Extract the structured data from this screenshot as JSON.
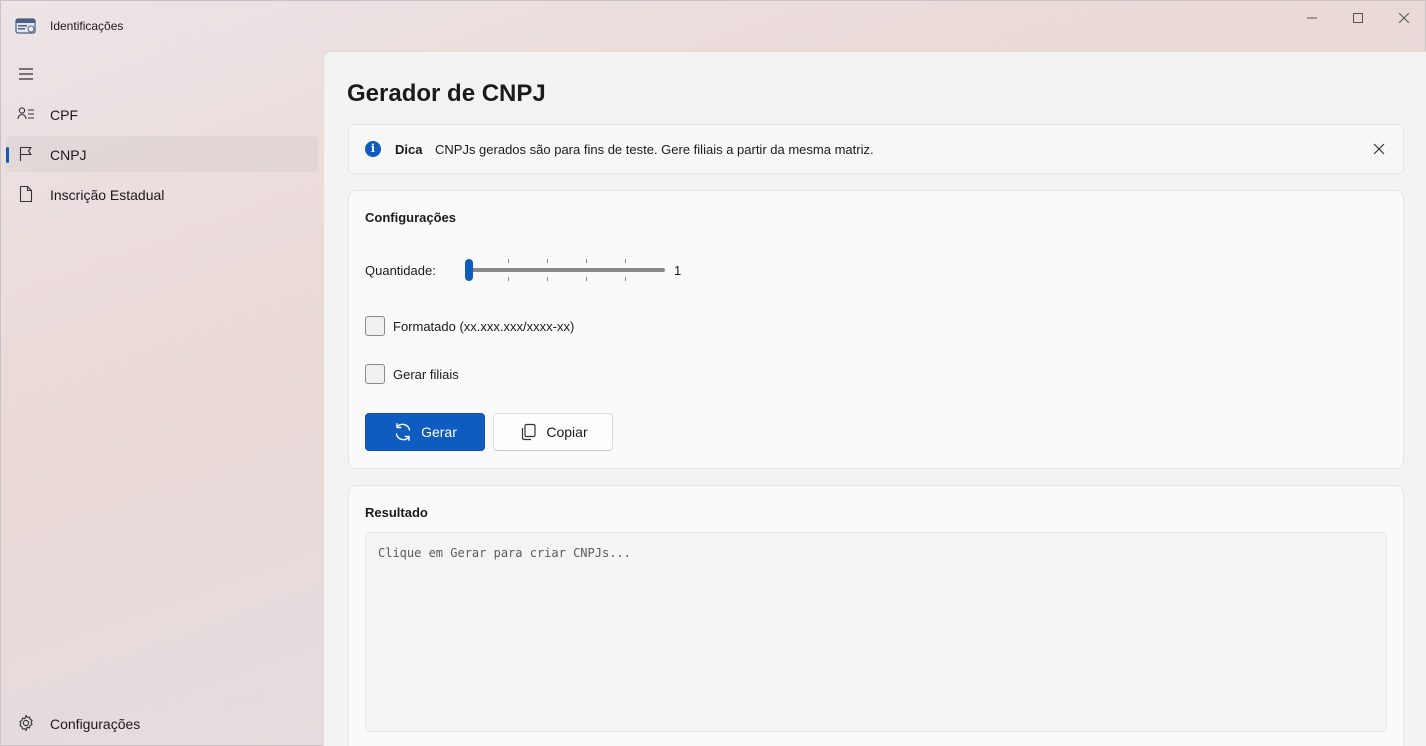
{
  "window": {
    "title": "Identificações"
  },
  "sidebar": {
    "items": [
      {
        "label": "CPF",
        "icon": "person-list-icon",
        "selected": false
      },
      {
        "label": "CNPJ",
        "icon": "flag-icon",
        "selected": true
      },
      {
        "label": "Inscrição Estadual",
        "icon": "document-icon",
        "selected": false
      }
    ],
    "settings_label": "Configurações"
  },
  "page": {
    "title": "Gerador de CNPJ"
  },
  "infobar": {
    "title": "Dica",
    "message": "CNPJs gerados são para fins de teste. Gere filiais a partir da mesma matriz."
  },
  "config": {
    "title": "Configurações",
    "quantity_label": "Quantidade:",
    "quantity_value": "1",
    "quantity_min": 1,
    "quantity_max": 6,
    "formatted_label": "Formatado (xx.xxx.xxx/xxxx-xx)",
    "formatted_checked": false,
    "branches_label": "Gerar filiais",
    "branches_checked": false,
    "generate_label": "Gerar",
    "copy_label": "Copiar"
  },
  "result": {
    "title": "Resultado",
    "placeholder": "Clique em Gerar para criar CNPJs..."
  },
  "colors": {
    "accent": "#0f5cc0"
  }
}
